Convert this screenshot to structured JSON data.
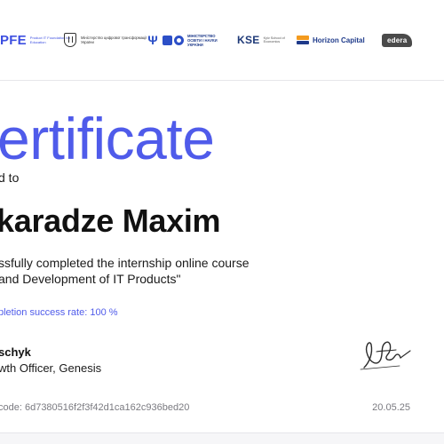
{
  "partners": {
    "upfe": {
      "mark": "PFE",
      "subtitle": "Product IT Foundation for Education"
    },
    "mdt": {
      "name": "Міністерство цифрової трансформації України"
    },
    "mon": {
      "name": "МІНІСТЕРСТВО ОСВІТИ І НАУКИ УКРАЇНИ"
    },
    "kse": {
      "mark": "KSE",
      "subtitle": "Kyiv School of Economics"
    },
    "horizon": {
      "name": "Horizon Capital"
    },
    "edera": {
      "name": "edera"
    }
  },
  "certificate": {
    "heading": "ertificate",
    "awarded_to": "d to",
    "recipient": "karadze Maxim",
    "course_line1": "ssfully completed the internship online course",
    "course_line2": "and Development of IT Products\"",
    "success_rate": "pletion success rate: 100 %",
    "signer_name": "schyk",
    "signer_role": "wth Officer, Genesis",
    "code": "code:   6d7380516f2f3f42d1ca162c936bed20",
    "date": "20.05.25"
  },
  "colors": {
    "accent": "#4f5bea",
    "text": "#111111",
    "muted": "#7a7a80",
    "upfe_blue": "#3d4fe0",
    "horizon_orange": "#f39a1e",
    "horizon_navy": "#1e3a8a"
  },
  "icons": {
    "mdt": "ukraine-coat-of-arms-icon",
    "mon": "trident-icon",
    "horizon": "horizon-capital-logo-icon",
    "signature": "handwritten-signature"
  }
}
